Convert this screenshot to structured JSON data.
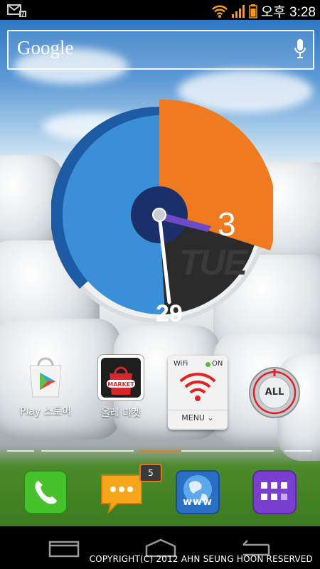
{
  "status_bar": {
    "time": "오후 3:28",
    "icons": [
      "email-notification-icon",
      "n-icon",
      "wifi-icon",
      "signal-icon",
      "battery-icon"
    ]
  },
  "search": {
    "brand": "Google",
    "mic_icon": "microphone-icon"
  },
  "clock_widget": {
    "hour": "3",
    "day": "TUE",
    "date": "29",
    "colors": {
      "hour_sector": "#f07a1f",
      "minute_sector": "#3a8fd8",
      "date_sector": "#2b2b2b"
    }
  },
  "apps": [
    {
      "label": "Play 스토어",
      "icon": "play-store-icon"
    },
    {
      "label": "올레 마켓",
      "icon": "olleh-market-icon"
    },
    {
      "label": "",
      "icon": "wifi-toggle-widget",
      "wifi_label": "WiFi",
      "wifi_state": "ON",
      "menu_label": "MENU"
    },
    {
      "label": "",
      "icon": "task-killer-widget",
      "button_label": "ALL"
    }
  ],
  "dock": [
    {
      "icon": "phone-icon"
    },
    {
      "icon": "messages-icon",
      "badge": "5"
    },
    {
      "icon": "browser-icon",
      "text": "www"
    },
    {
      "icon": "app-drawer-icon"
    }
  ],
  "nav": {
    "icons": [
      "back-icon",
      "home-icon",
      "recent-apps-icon"
    ]
  },
  "copyright": "COPYRIGHT(C) 2012 AHN SEUNG HOON RESERVED"
}
